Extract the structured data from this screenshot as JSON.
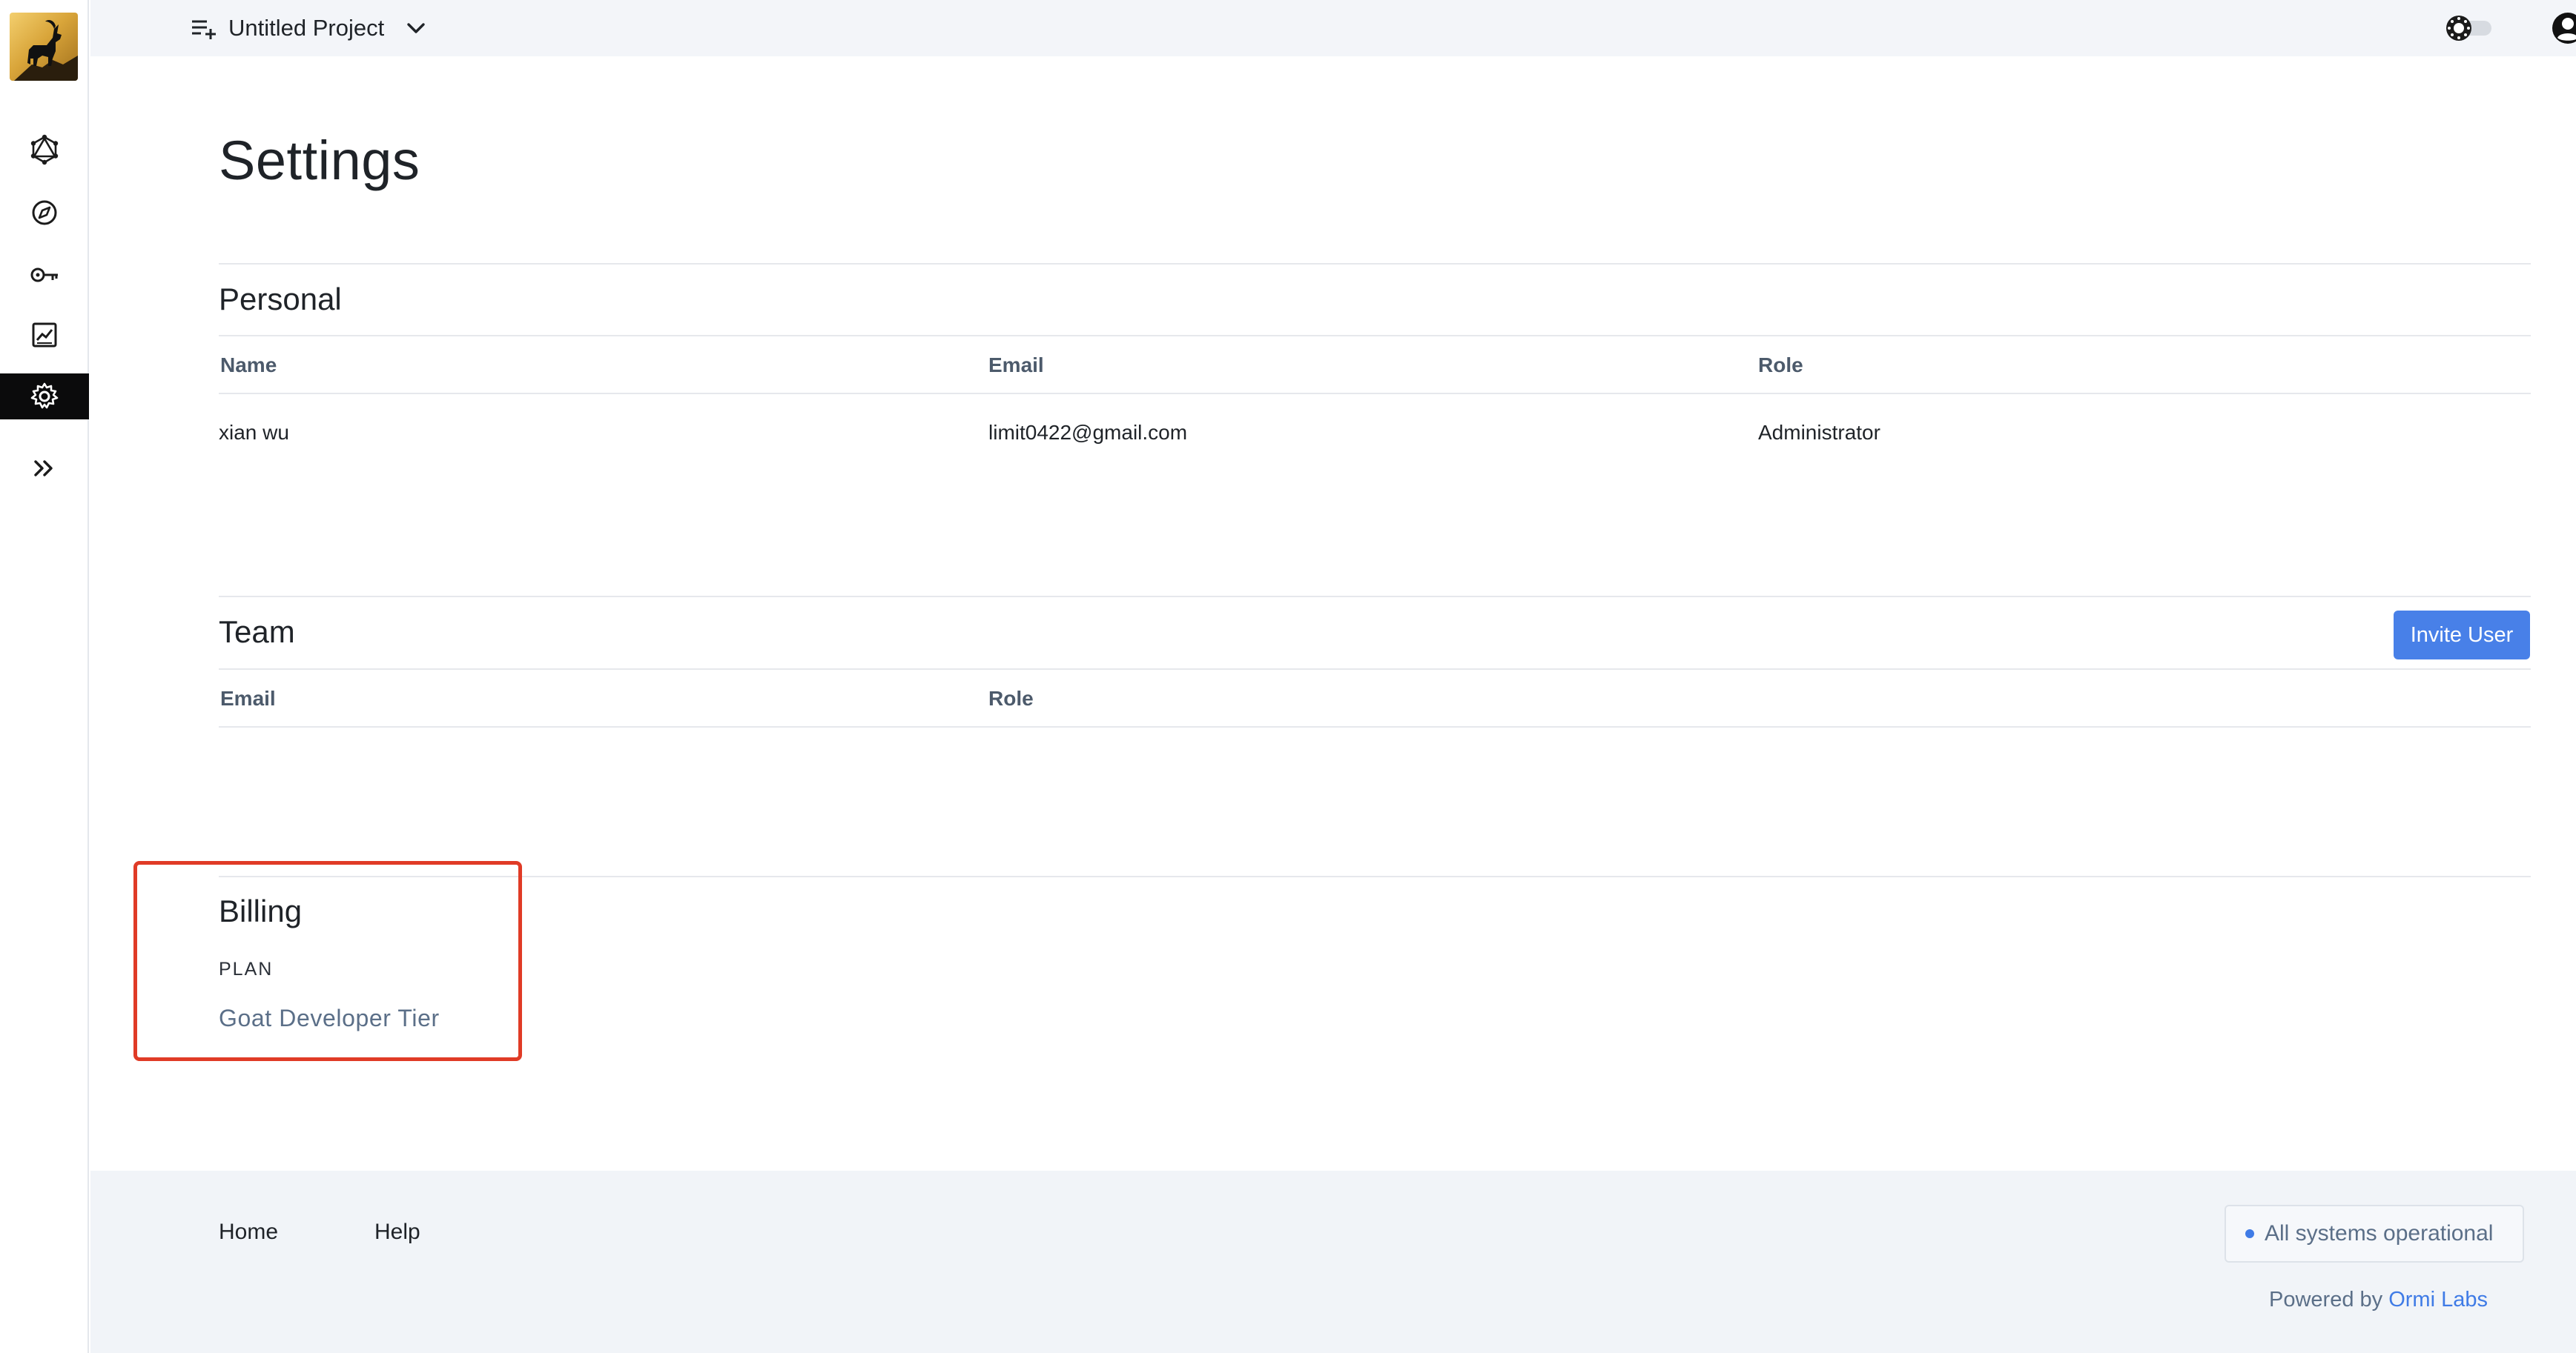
{
  "header": {
    "project_name": "Untitled Project",
    "project_icon": "playlist-add-icon",
    "dropdown_icon": "chevron-down-icon",
    "theme_toggle_icon": "sun-icon",
    "account_icon": "user-circle-icon"
  },
  "sidebar": {
    "logo": "goat-logo",
    "items": [
      {
        "name": "graphql-icon",
        "active": false
      },
      {
        "name": "compass-icon",
        "active": false
      },
      {
        "name": "key-icon",
        "active": false
      },
      {
        "name": "chart-icon",
        "active": false
      },
      {
        "name": "gear-icon",
        "active": true
      },
      {
        "name": "double-chevron-right-icon",
        "active": false
      }
    ]
  },
  "page": {
    "title": "Settings"
  },
  "personal": {
    "title": "Personal",
    "columns": [
      "Name",
      "Email",
      "Role"
    ],
    "row": {
      "name": "xian wu",
      "email": "limit0422@gmail.com",
      "role": "Administrator"
    }
  },
  "team": {
    "title": "Team",
    "invite_label": "Invite User",
    "columns": [
      "Email",
      "Role"
    ]
  },
  "billing": {
    "title": "Billing",
    "plan_label": "PLAN",
    "plan_value": "Goat Developer Tier"
  },
  "footer": {
    "links": [
      "Home",
      "Help"
    ],
    "status_text": "All systems operational",
    "powered_prefix": "Powered by",
    "powered_brand": "Ormi Labs"
  },
  "colors": {
    "accent": "#4880e8",
    "highlight": "#e03b26",
    "active_nav": "#0b0b0c"
  }
}
